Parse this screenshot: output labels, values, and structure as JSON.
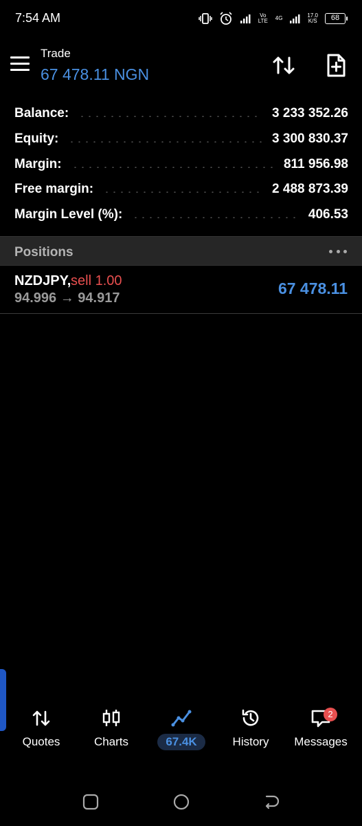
{
  "status_bar": {
    "time": "7:54 AM",
    "network_type": "Vo LTE",
    "network_gen": "4G",
    "speed": "17.0",
    "speed_unit": "K/S",
    "battery": "68"
  },
  "header": {
    "title": "Trade",
    "balance_display": "67 478.11 NGN"
  },
  "account": [
    {
      "label": "Balance:",
      "value": "3 233 352.26"
    },
    {
      "label": "Equity:",
      "value": "3 300 830.37"
    },
    {
      "label": "Margin:",
      "value": "811 956.98"
    },
    {
      "label": "Free margin:",
      "value": "2 488 873.39"
    },
    {
      "label": "Margin Level (%):",
      "value": "406.53"
    }
  ],
  "positions": {
    "title": "Positions",
    "items": [
      {
        "symbol": "NZDJPY,",
        "side": "sell 1.00",
        "open_price": "94.996",
        "arrow": "→",
        "current_price": "94.917",
        "profit": "67 478.11"
      }
    ]
  },
  "nav": {
    "quotes": "Quotes",
    "charts": "Charts",
    "trade": "67.4K",
    "history": "History",
    "messages": "Messages",
    "messages_badge": "2"
  },
  "colors": {
    "accent": "#4a90e2",
    "sell": "#e84f4f",
    "background": "#000000",
    "section_bg": "#262626"
  }
}
